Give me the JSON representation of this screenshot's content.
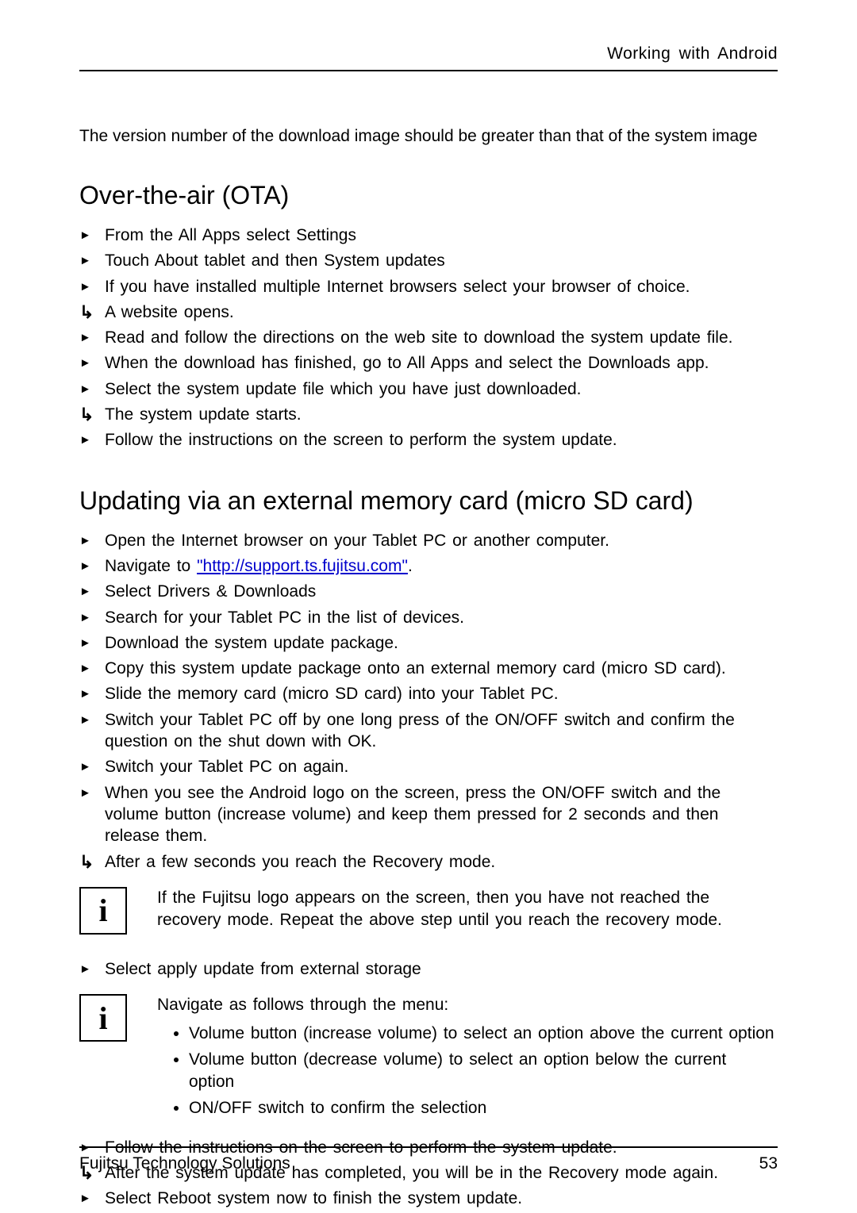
{
  "header": "Working with Android",
  "intro": "The version number of the download image should be greater than that of the system image",
  "section_ota": {
    "title": "Over-the-air (OTA)",
    "steps": [
      {
        "m": "arrow",
        "t": "From the All Apps select Settings"
      },
      {
        "m": "arrow",
        "t": "Touch About tablet and then System updates"
      },
      {
        "m": "arrow",
        "t": "If you have installed multiple Internet browsers select your browser of choice."
      },
      {
        "m": "result",
        "t": "A website opens."
      },
      {
        "m": "arrow",
        "t": "Read and follow the directions on the web site to download the system update ﬁle."
      },
      {
        "m": "arrow",
        "t": "When the download has ﬁnished, go to All Apps and select the Downloads app."
      },
      {
        "m": "arrow",
        "t": "Select the system update ﬁle which you have just downloaded."
      },
      {
        "m": "result",
        "t": "The system update starts."
      },
      {
        "m": "arrow",
        "t": "Follow the instructions on the screen to perform the system update."
      }
    ]
  },
  "section_sd": {
    "title": "Updating via an external memory card (micro SD card)",
    "steps_pre_link": {
      "m": "arrow",
      "t": "Open the Internet browser on your Tablet PC or another computer."
    },
    "nav_prefix": "Navigate to ",
    "nav_link": "\"http://support.ts.fujitsu.com\"",
    "nav_suffix": ".",
    "steps_post": [
      {
        "m": "arrow",
        "t": "Select Drivers & Downloads"
      },
      {
        "m": "arrow",
        "t": "Search for your Tablet PC in the list of devices."
      },
      {
        "m": "arrow",
        "t": "Download the system update package."
      },
      {
        "m": "arrow",
        "t": "Copy this system update package onto an external memory card (micro SD card)."
      },
      {
        "m": "arrow",
        "t": "Slide the memory card (micro SD card) into your Tablet PC."
      },
      {
        "m": "arrow",
        "t": "Switch your Tablet PC off by one long press of the ON/OFF switch and conﬁrm the question on the shut down with OK."
      },
      {
        "m": "arrow",
        "t": "Switch your Tablet PC on again."
      },
      {
        "m": "arrow",
        "t": "When you see the Android logo on the screen, press the ON/OFF switch and the volume button (increase volume) and keep them pressed for 2 seconds and then release them."
      },
      {
        "m": "result",
        "t": "After a few seconds you reach the Recovery mode."
      }
    ]
  },
  "note1": "If the Fujitsu logo appears on the screen, then you have not reached the recovery mode. Repeat the above step until you reach the recovery mode.",
  "apply_step": {
    "m": "arrow",
    "t": "Select apply update from external storage"
  },
  "note2_intro": "Navigate as follows through the menu:",
  "note2_bullets": [
    "Volume button (increase volume) to select an option above the current option",
    "Volume button (decrease volume) to select an option below the current option",
    "ON/OFF switch to conﬁrm the selection"
  ],
  "final_steps": [
    {
      "m": "arrow",
      "t": "Follow the instructions on the screen to perform the system update."
    },
    {
      "m": "result",
      "t": "After the system update has completed, you will be in the Recovery mode again."
    },
    {
      "m": "arrow",
      "t": "Select Reboot system now to ﬁnish the system update."
    }
  ],
  "footer_left": "Fujitsu Technology Solutions",
  "footer_right": "53",
  "info_glyph": "i"
}
